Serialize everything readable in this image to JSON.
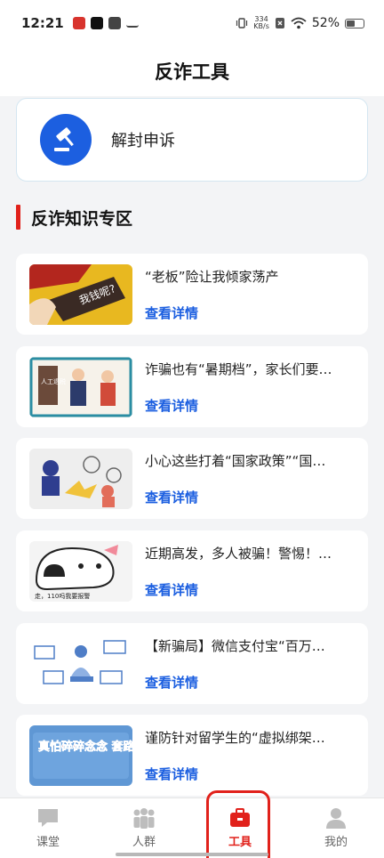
{
  "status_bar": {
    "time": "12:21",
    "net_speed_value": "334",
    "net_speed_unit": "KB/s",
    "battery": "52%",
    "battery_level": 0.52
  },
  "header": {
    "title": "反诈工具"
  },
  "unblock_card": {
    "label": "解封申诉",
    "icon": "gavel-icon"
  },
  "section": {
    "title": "反诈知识专区"
  },
  "articles": [
    {
      "title": "“老板”险让我倾家荡产",
      "link": "查看详情",
      "thumb_text": "我钱呢?"
    },
    {
      "title": "诈骗也有“暑期档”，家长们要…",
      "link": "查看详情",
      "thumb_text": "人工退税"
    },
    {
      "title": "小心这些打着“国家政策”“国…",
      "link": "查看详情",
      "thumb_text": ""
    },
    {
      "title": "近期高发，多人被骗！警惕！…",
      "link": "查看详情",
      "thumb_text": "走，110吗我要报警"
    },
    {
      "title": "【新骗局】微信支付宝“百万…",
      "link": "查看详情",
      "thumb_text": ""
    },
    {
      "title": "谨防针对留学生的“虚拟绑架…",
      "link": "查看详情",
      "thumb_text": "真怕碎碎念念 套路岁岁年年"
    }
  ],
  "tabs": [
    {
      "label": "课堂",
      "icon": "chat-icon",
      "active": false
    },
    {
      "label": "人群",
      "icon": "group-icon",
      "active": false
    },
    {
      "label": "工具",
      "icon": "toolbox-icon",
      "active": true
    },
    {
      "label": "我的",
      "icon": "person-icon",
      "active": false
    }
  ],
  "colors": {
    "accent": "#1c5fe0",
    "brand_red": "#e1211b",
    "background": "#f3f4f6"
  }
}
